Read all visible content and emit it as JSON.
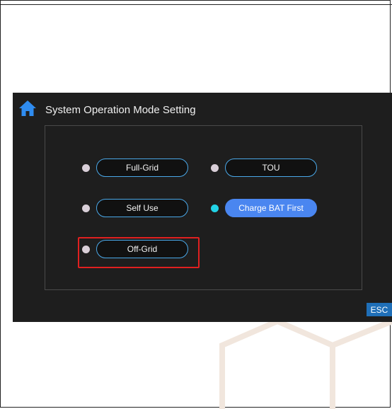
{
  "screen": {
    "title": "System Operation Mode Setting"
  },
  "modes": [
    {
      "label": "Full-Grid",
      "selected": false
    },
    {
      "label": "TOU",
      "selected": false
    },
    {
      "label": "Self Use",
      "selected": false
    },
    {
      "label": "Charge BAT First",
      "selected": true
    },
    {
      "label": "Off-Grid",
      "selected": false
    }
  ],
  "esc_label": "ESC",
  "colors": {
    "screen_bg": "#1e1e1e",
    "pill_border": "#4aa8e8",
    "selected_pill": "#4a86f0",
    "active_dot": "#22d3e6",
    "inactive_dot": "#d9cfd8",
    "highlight": "#e02020",
    "esc_bg": "#1f6fb8"
  },
  "icons": {
    "home": "home-icon"
  }
}
